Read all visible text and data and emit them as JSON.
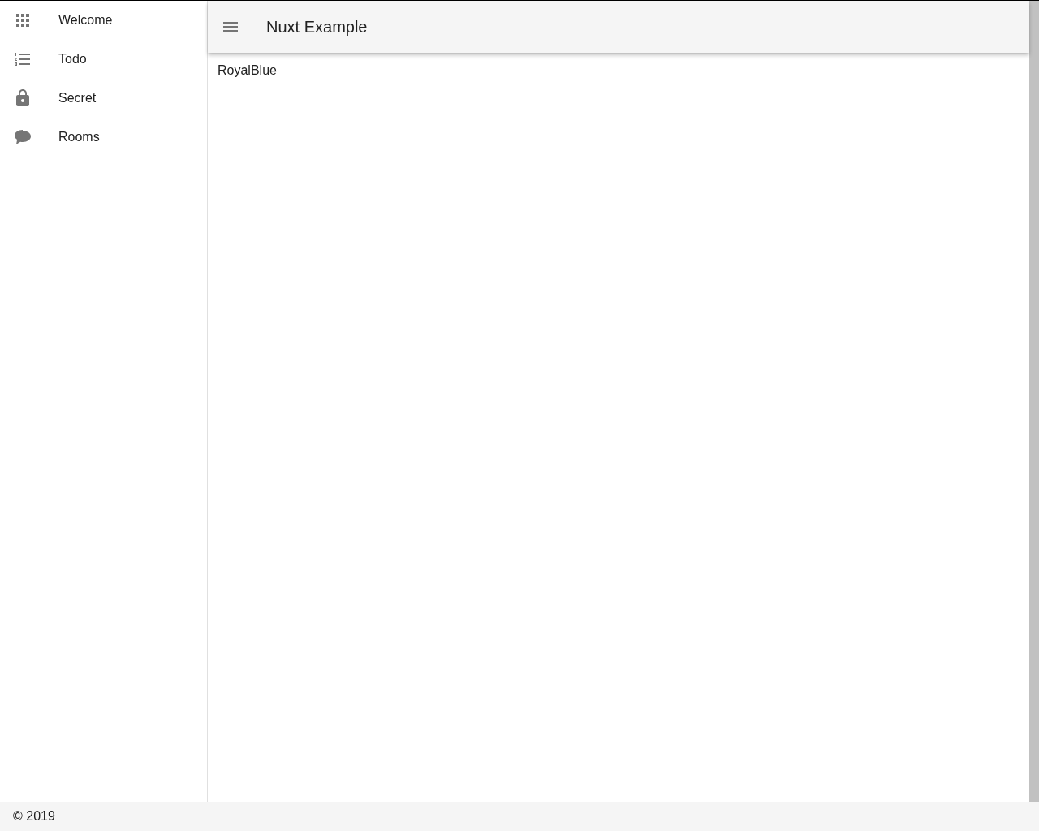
{
  "sidebar": {
    "items": [
      {
        "label": "Welcome"
      },
      {
        "label": "Todo"
      },
      {
        "label": "Secret"
      },
      {
        "label": "Rooms"
      }
    ]
  },
  "toolbar": {
    "title": "Nuxt Example"
  },
  "content": {
    "text": "RoyalBlue"
  },
  "footer": {
    "text": "© 2019"
  }
}
